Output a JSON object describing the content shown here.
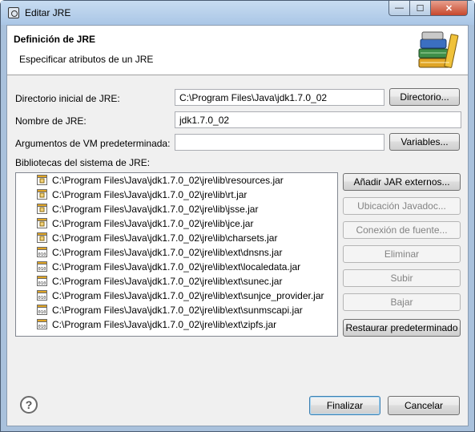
{
  "window": {
    "title": "Editar JRE",
    "minimize_glyph": "—",
    "maximize_glyph": "☐",
    "close_glyph": "✕"
  },
  "header": {
    "title": "Definición de JRE",
    "subtitle": "Especificar atributos de un JRE",
    "icon": "library-books-icon"
  },
  "form": {
    "home_label": "Directorio inicial de JRE:",
    "home_value": "C:\\Program Files\\Java\\jdk1.7.0_02",
    "home_button": "Directorio...",
    "name_label": "Nombre de JRE:",
    "name_value": "jdk1.7.0_02",
    "vmargs_label": "Argumentos de VM predeterminada:",
    "vmargs_value": "",
    "vmargs_button": "Variables...",
    "libs_label": "Bibliotecas del sistema de JRE:"
  },
  "libraries": [
    {
      "path": "C:\\Program Files\\Java\\jdk1.7.0_02\\jre\\lib\\resources.jar",
      "icon": "jar-icon"
    },
    {
      "path": "C:\\Program Files\\Java\\jdk1.7.0_02\\jre\\lib\\rt.jar",
      "icon": "jar-icon"
    },
    {
      "path": "C:\\Program Files\\Java\\jdk1.7.0_02\\jre\\lib\\jsse.jar",
      "icon": "jar-icon"
    },
    {
      "path": "C:\\Program Files\\Java\\jdk1.7.0_02\\jre\\lib\\jce.jar",
      "icon": "jar-icon"
    },
    {
      "path": "C:\\Program Files\\Java\\jdk1.7.0_02\\jre\\lib\\charsets.jar",
      "icon": "jar-icon"
    },
    {
      "path": "C:\\Program Files\\Java\\jdk1.7.0_02\\jre\\lib\\ext\\dnsns.jar",
      "icon": "binary-jar-icon"
    },
    {
      "path": "C:\\Program Files\\Java\\jdk1.7.0_02\\jre\\lib\\ext\\localedata.jar",
      "icon": "binary-jar-icon"
    },
    {
      "path": "C:\\Program Files\\Java\\jdk1.7.0_02\\jre\\lib\\ext\\sunec.jar",
      "icon": "binary-jar-icon"
    },
    {
      "path": "C:\\Program Files\\Java\\jdk1.7.0_02\\jre\\lib\\ext\\sunjce_provider.jar",
      "icon": "binary-jar-icon"
    },
    {
      "path": "C:\\Program Files\\Java\\jdk1.7.0_02\\jre\\lib\\ext\\sunmscapi.jar",
      "icon": "binary-jar-icon"
    },
    {
      "path": "C:\\Program Files\\Java\\jdk1.7.0_02\\jre\\lib\\ext\\zipfs.jar",
      "icon": "binary-jar-icon"
    }
  ],
  "side_buttons": {
    "add_external_jars": "Añadir JAR externos...",
    "javadoc_location": "Ubicación Javadoc...",
    "source_attachment": "Conexión de fuente...",
    "remove": "Eliminar",
    "up": "Subir",
    "down": "Bajar",
    "restore_default": "Restaurar predeterminado"
  },
  "footer": {
    "help_glyph": "?",
    "finish": "Finalizar",
    "cancel": "Cancelar"
  },
  "colors": {
    "title_gradient_top": "#c8dcf1",
    "close_button": "#c7482d",
    "dialog_bg": "#f0f0f0",
    "default_button_border": "#3c7fb1",
    "jar_icon_accent": "#e0a526"
  }
}
